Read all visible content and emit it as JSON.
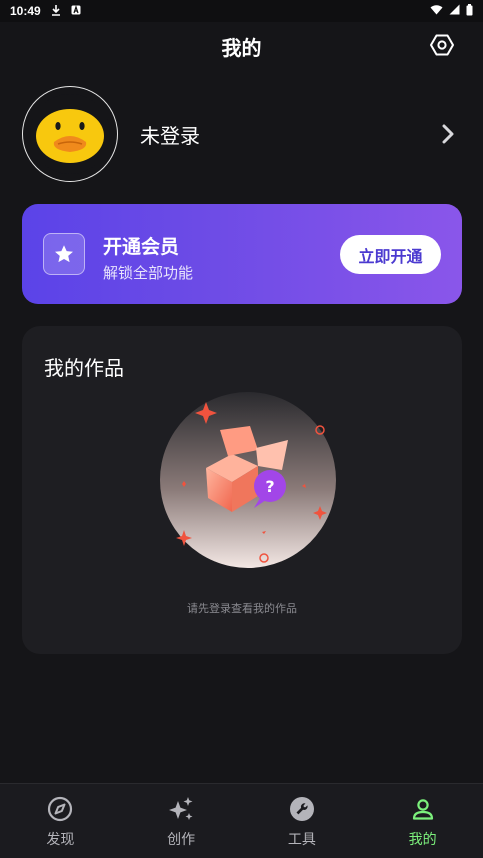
{
  "status_bar": {
    "time": "10:49"
  },
  "header": {
    "title": "我的"
  },
  "profile": {
    "login_label": "未登录"
  },
  "vip": {
    "title": "开通会员",
    "subtitle": "解锁全部功能",
    "button_label": "立即开通"
  },
  "works": {
    "title": "我的作品",
    "empty_text": "请先登录查看我的作品"
  },
  "nav": {
    "items": [
      {
        "label": "发现",
        "icon": "compass-icon"
      },
      {
        "label": "创作",
        "icon": "sparkles-icon"
      },
      {
        "label": "工具",
        "icon": "wrench-icon"
      },
      {
        "label": "我的",
        "icon": "person-icon"
      }
    ],
    "active_index": 3
  },
  "colors": {
    "background": "#151518",
    "card": "#1e1e22",
    "vip_gradient_start": "#5b43e8",
    "vip_gradient_end": "#8a56ea",
    "nav_active": "#7cf07c",
    "avatar_yellow": "#f8c80e",
    "beak_orange": "#f08a1c"
  }
}
